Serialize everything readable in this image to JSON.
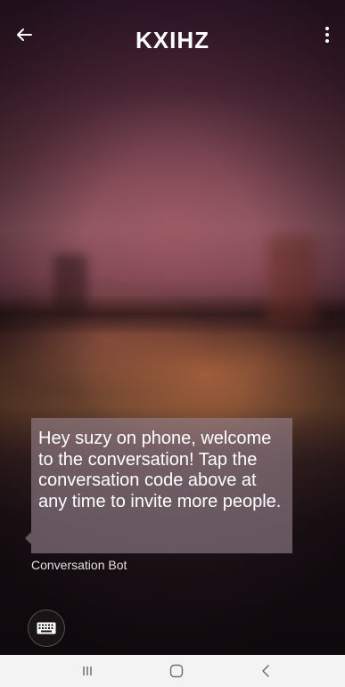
{
  "header": {
    "title": "KXIHZ",
    "back_icon": "arrow-left-icon",
    "menu_icon": "more-vertical-icon"
  },
  "conversation": {
    "messages": [
      {
        "text": "Hey suzy on phone, welcome to the conversation! Tap the conversation code above at any time to invite more people.",
        "sender": "Conversation Bot"
      }
    ]
  },
  "composer": {
    "keyboard_icon": "keyboard-icon"
  },
  "system_nav": {
    "recents_icon": "recents-icon",
    "home_icon": "home-icon",
    "back_icon": "chevron-left-icon"
  },
  "colors": {
    "bubble": "#968289",
    "text": "#ffffff",
    "navbar": "#f3f3f3",
    "nav_icons": "#6e6e6e"
  }
}
